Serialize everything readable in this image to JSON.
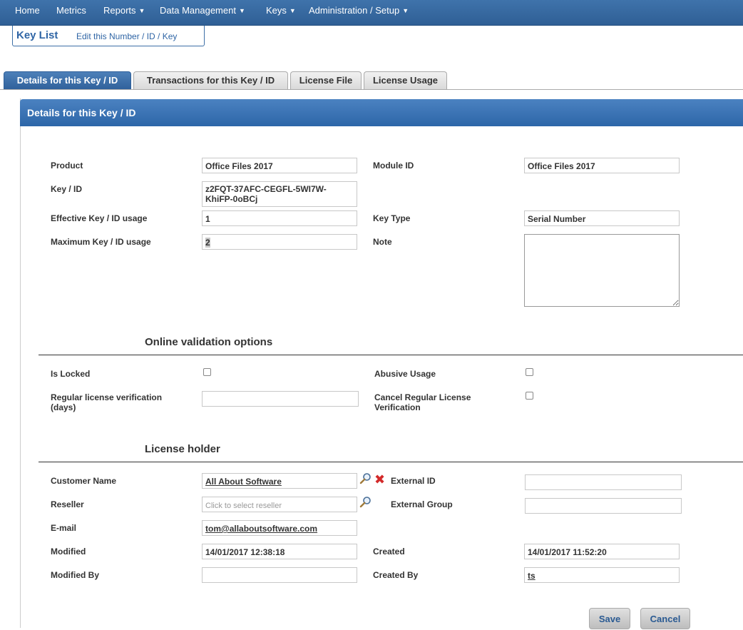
{
  "nav": {
    "home": "Home",
    "metrics": "Metrics",
    "reports": "Reports",
    "data_management": "Data Management",
    "keys": "Keys",
    "administration": "Administration / Setup"
  },
  "breadcrumb": {
    "title": "Key List",
    "subtitle": "Edit this Number / ID / Key"
  },
  "tabs": [
    {
      "label": "Details for this Key / ID",
      "active": true
    },
    {
      "label": "Transactions for this Key / ID",
      "active": false
    },
    {
      "label": "License File",
      "active": false
    },
    {
      "label": "License Usage",
      "active": false
    }
  ],
  "panel": {
    "title": "Details for this Key / ID"
  },
  "details": {
    "product_label": "Product",
    "product_value": "Office Files 2017",
    "module_id_label": "Module ID",
    "module_id_value": "Office Files 2017",
    "key_id_label": "Key / ID",
    "key_id_value_line1": "z2FQT-37AFC-CEGFL-5WI7W-",
    "key_id_value_line2": "KhiFP-0oBCj",
    "effective_usage_label": "Effective Key / ID usage",
    "effective_usage_value": "1",
    "key_type_label": "Key Type",
    "key_type_value": "Serial Number",
    "max_usage_label": "Maximum Key / ID usage",
    "max_usage_value": "2",
    "note_label": "Note",
    "note_value": ""
  },
  "online_validation": {
    "title": "Online validation options",
    "is_locked_label": "Is Locked",
    "is_locked": false,
    "abusive_usage_label": "Abusive Usage",
    "abusive_usage": false,
    "regular_verification_label_line1": "Regular license verification",
    "regular_verification_label_line2": "(days)",
    "regular_verification_value": "",
    "cancel_verification_label_line1": "Cancel Regular License",
    "cancel_verification_label_line2": "Verification",
    "cancel_verification": false
  },
  "license_holder": {
    "title": "License holder",
    "customer_name_label": "Customer Name",
    "customer_name_value": "All About Software",
    "external_id_label": "External ID",
    "external_id_value": "",
    "reseller_label": "Reseller",
    "reseller_placeholder": "Click to select reseller",
    "external_group_label": "External Group",
    "external_group_value": "",
    "email_label": "E-mail",
    "email_value": "tom@allaboutsoftware.com",
    "modified_label": "Modified",
    "modified_value": "14/01/2017 12:38:18",
    "created_label": "Created",
    "created_value": "14/01/2017 11:52:20",
    "modified_by_label": "Modified By",
    "modified_by_value": "",
    "created_by_label": "Created By",
    "created_by_value": "ts"
  },
  "buttons": {
    "save": "Save",
    "cancel": "Cancel"
  },
  "icons": {
    "search": "magnifier-icon",
    "delete": "red-x-icon",
    "caret": "caret-down-icon"
  },
  "colors": {
    "nav_bg": "#3f73ab",
    "accent": "#2f65a5",
    "delete_red": "#d32a2a"
  }
}
